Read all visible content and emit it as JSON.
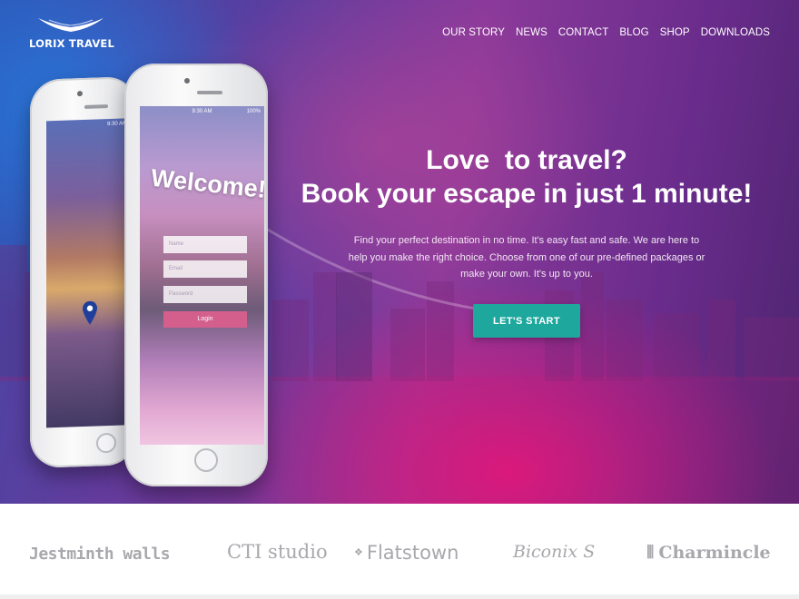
{
  "brand": {
    "name": "LORIX TRAVEL"
  },
  "nav": {
    "items": [
      "OUR STORY",
      "NEWS",
      "CONTACT",
      "BLOG",
      "SHOP",
      "DOWNLOADS"
    ]
  },
  "hero": {
    "headline_line1": "Love  to travel?",
    "headline_line2": "Book your escape in just 1 minute!",
    "description": "Find your perfect destination in no time. It's easy fast and safe. We are here to help you make the right choice. Choose from one of our pre-defined packages or make your own. It's up to you.",
    "cta_label": "LET'S START"
  },
  "phone_back": {
    "status_time": "9:30 AM"
  },
  "phone_front": {
    "status_time": "9:30 AM",
    "battery": "100%",
    "welcome": "Welcome!",
    "name_placeholder": "Name",
    "email_placeholder": "Email",
    "password_placeholder": "Password",
    "login_label": "Login"
  },
  "partners": [
    "Jestminth walls",
    "CTI studio",
    "Flatstown",
    "Biconix S",
    "Charmincle"
  ],
  "colors": {
    "accent": "#1ea89d",
    "hero_pink": "#e8147a",
    "hero_blue": "#2d4fae",
    "brand_gray": "#a8a8ad"
  }
}
